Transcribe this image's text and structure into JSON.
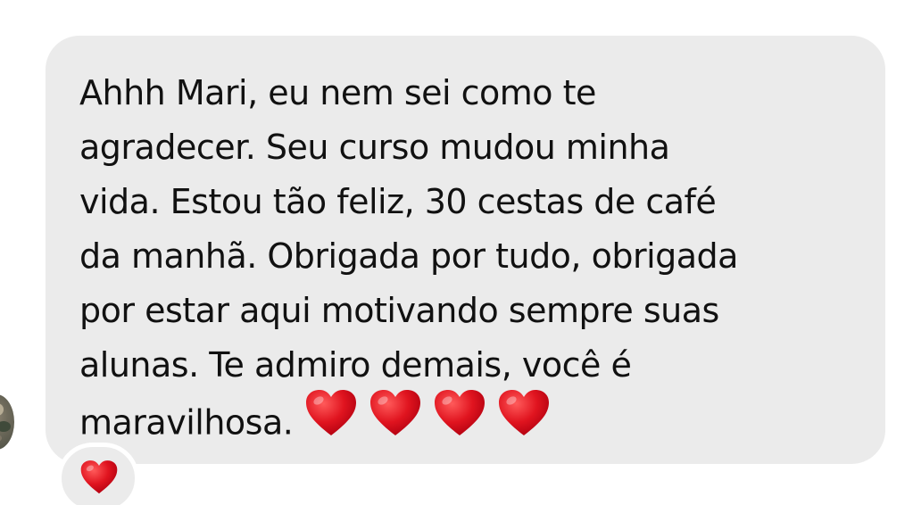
{
  "message": {
    "text": "Ahhh Mari, eu nem sei como te\nagradecer. Seu curso mudou minha\nvida. Estou tão feliz, 30 cestas de café\nda manhã. Obrigada por tudo, obrigada\npor estar aqui motivando sempre suas\nalunas. Te admiro demais, você é\nmaravilhosa.",
    "emoji": [
      "heart-icon",
      "heart-icon",
      "heart-icon",
      "heart-icon"
    ]
  },
  "reaction": {
    "emoji": "heart-icon"
  },
  "colors": {
    "bubble": "#ebebeb",
    "text": "#111111",
    "heart": "#e0141f",
    "background": "#ffffff"
  }
}
